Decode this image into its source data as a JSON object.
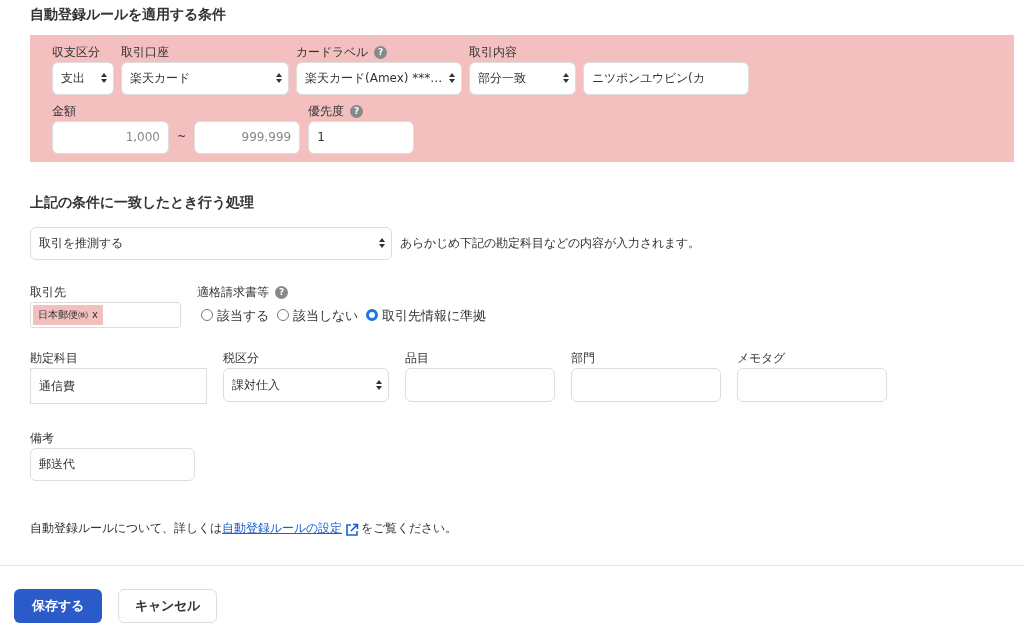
{
  "conditions": {
    "title": "自動登録ルールを適用する条件",
    "filters": [
      {
        "label": "収支区分",
        "kind": "select",
        "value": "支出"
      },
      {
        "label": "取引口座",
        "kind": "select",
        "value": "楽天カード"
      },
      {
        "label": "カードラベル",
        "help": "?",
        "kind": "select",
        "value": "楽天カード(Amex) ***…"
      },
      {
        "label": "取引内容",
        "kind": "select",
        "value": "部分一致"
      },
      {
        "kind": "text",
        "value": "ニツポンユウビン(カ"
      }
    ],
    "amount": {
      "label": "金額",
      "min_placeholder": "1,000",
      "separator": "~",
      "max_placeholder": "999,999"
    },
    "priority": {
      "label": "優先度",
      "help": "?",
      "value": "1"
    }
  },
  "action": {
    "title": "上記の条件に一致したとき行う処理",
    "select": "取引を推測する",
    "note": "あらかじめ下記の勘定科目などの内容が入力されます。"
  },
  "partner": {
    "label": "取引先",
    "tags": [
      {
        "text": "日本郵便㈱",
        "remove": "x"
      }
    ]
  },
  "invoice": {
    "label": "適格請求書等",
    "help": "?",
    "options": [
      {
        "label": "該当する",
        "selected": false
      },
      {
        "label": "該当しない",
        "selected": false
      },
      {
        "label": "取引先情報に準拠",
        "selected": true
      }
    ]
  },
  "details": [
    {
      "label": "勘定科目",
      "kind": "flat",
      "value": "通信費"
    },
    {
      "label": "税区分",
      "kind": "select",
      "value": "課対仕入"
    },
    {
      "label": "品目",
      "kind": "text"
    },
    {
      "label": "部門",
      "kind": "text"
    },
    {
      "label": "メモタグ",
      "kind": "text"
    }
  ],
  "remarks": {
    "label": "備考",
    "value": "郵送代"
  },
  "footnote": {
    "before": "自動登録ルールについて、詳しくは",
    "link": "自動登録ルールの設定",
    "after": "をご覧ください。"
  },
  "buttons": [
    {
      "label": "保存する",
      "kind": "primary"
    },
    {
      "label": "キャンセル",
      "kind": "secondary"
    }
  ]
}
